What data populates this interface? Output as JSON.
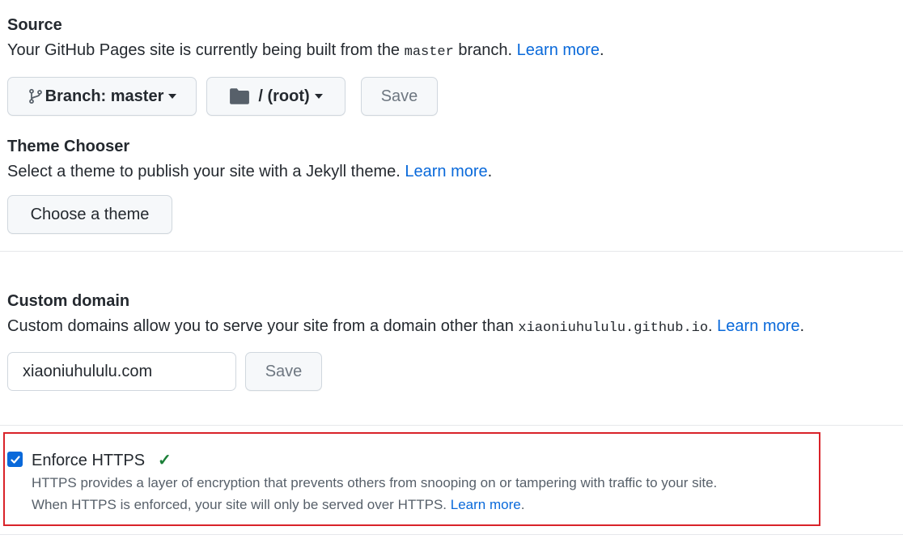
{
  "source": {
    "heading": "Source",
    "desc_before": "Your GitHub Pages site is currently being built from the ",
    "desc_branch_code": "master",
    "desc_after": " branch. ",
    "learn_more": "Learn more",
    "period": ".",
    "branch_button_label": "Branch: master",
    "folder_button_label": "/ (root)",
    "save_label": "Save"
  },
  "theme": {
    "heading": "Theme Chooser",
    "desc": "Select a theme to publish your site with a Jekyll theme. ",
    "learn_more": "Learn more",
    "period": ".",
    "button_label": "Choose a theme"
  },
  "custom_domain": {
    "heading": "Custom domain",
    "desc_before": "Custom domains allow you to serve your site from a domain other than ",
    "desc_domain_code": "xiaoniuhululu.github.io",
    "desc_after": ". ",
    "learn_more": "Learn more",
    "period": ".",
    "input_value": "xiaoniuhululu.com",
    "save_label": "Save"
  },
  "https": {
    "label": "Enforce HTTPS",
    "checked": true,
    "check_mark": "✓",
    "line1": "HTTPS provides a layer of encryption that prevents others from snooping on or tampering with traffic to your site.",
    "line2_before": "When HTTPS is enforced, your site will only be served over HTTPS. ",
    "learn_more": "Learn more",
    "period": "."
  },
  "colors": {
    "link": "#0969da",
    "highlight_border": "#d9232a",
    "success_check": "#1a7f37"
  }
}
